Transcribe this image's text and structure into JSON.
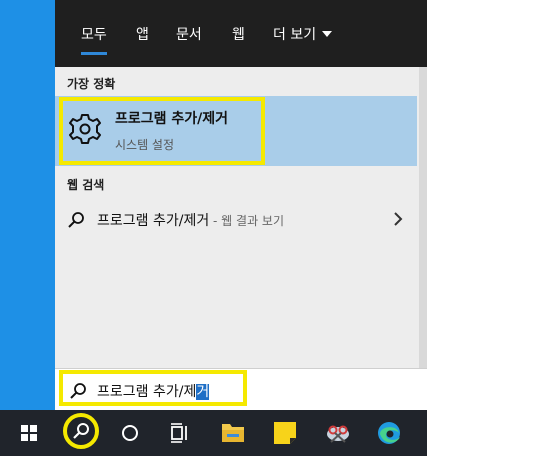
{
  "search_panel": {
    "tabs": [
      {
        "label": "모두",
        "active": true
      },
      {
        "label": "앱"
      },
      {
        "label": "문서"
      },
      {
        "label": "웹"
      },
      {
        "label": "더 보기"
      }
    ],
    "best_match": {
      "heading": "가장 정확",
      "title": "프로그램 추가/제거",
      "subtitle": "시스템 설정",
      "icon": "gear-icon"
    },
    "web_search": {
      "heading": "웹 검색",
      "query": "프로그램 추가/제거",
      "suffix": " - 웹 결과 보기",
      "icon": "search-icon"
    }
  },
  "search_box": {
    "value_before_selection": "프로그램 추가/제",
    "selected_text": "거",
    "icon": "search-icon"
  },
  "taskbar": {
    "icons": [
      "windows-start-icon",
      "search-icon",
      "cortana-icon",
      "task-view-icon",
      "file-explorer-icon",
      "sticky-notes-icon",
      "snipping-tool-icon",
      "edge-icon"
    ]
  },
  "colors": {
    "highlight": "#f5e900",
    "best_match_bg": "#a9cde9",
    "taskbar_bg": "#20242b",
    "topbar_bg": "#1f1f1f",
    "desktop_bg": "#1e90e6"
  }
}
